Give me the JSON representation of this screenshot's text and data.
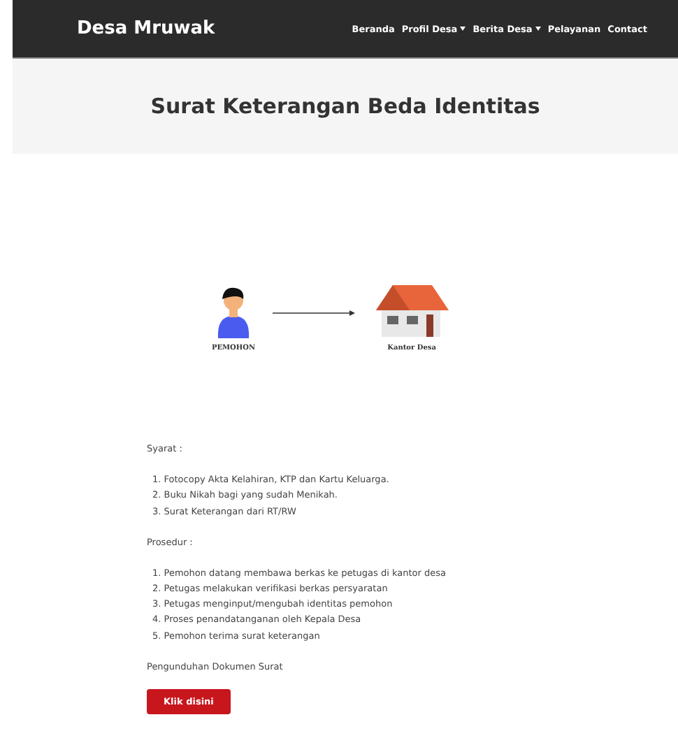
{
  "navbar": {
    "brand": "Desa Mruwak",
    "links": [
      {
        "label": "Beranda",
        "dropdown": false
      },
      {
        "label": "Profil Desa",
        "dropdown": true
      },
      {
        "label": "Berita Desa",
        "dropdown": true
      },
      {
        "label": "Pelayanan",
        "dropdown": false
      },
      {
        "label": "Contact",
        "dropdown": false
      }
    ]
  },
  "header": {
    "title": "Surat Keterangan Beda Identitas"
  },
  "diagram": {
    "from_label": "PEMOHON",
    "to_label": "Kantor Desa"
  },
  "requirements": {
    "heading": "Syarat :",
    "items": [
      "1. Fotocopy Akta Kelahiran, KTP dan Kartu Keluarga.",
      "2. Buku Nikah bagi yang sudah Menikah.",
      "3. Surat Keterangan dari RT/RW"
    ]
  },
  "procedure": {
    "heading": "Prosedur :",
    "items": [
      "1. Pemohon datang membawa berkas ke petugas di kantor desa",
      "2. Petugas melakukan verifikasi berkas persyaratan",
      "3. Petugas menginput/mengubah identitas pemohon",
      "4. Proses penandatanganan oleh Kepala Desa",
      "5. Pemohon terima surat keterangan"
    ]
  },
  "download": {
    "label": "Pengunduhan Dokumen Surat",
    "button": "Klik disini"
  }
}
